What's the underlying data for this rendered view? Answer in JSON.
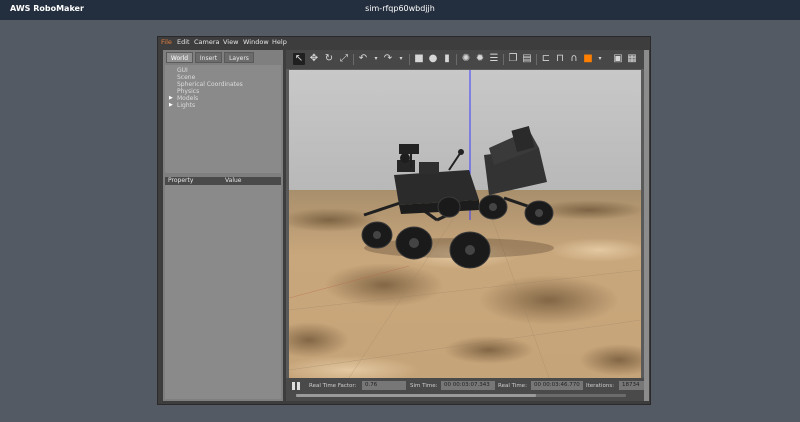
{
  "app": {
    "brand": "AWS RoboMaker",
    "sim_id": "sim-rfqp60wbdjjh"
  },
  "menu": [
    "File",
    "Edit",
    "Camera",
    "View",
    "Window",
    "Help"
  ],
  "left_panel": {
    "tabs": [
      "World",
      "Insert",
      "Layers"
    ],
    "tree": [
      "GUI",
      "Scene",
      "Spherical Coordinates",
      "Physics",
      "Models",
      "Lights"
    ],
    "props_header": [
      "Property",
      "Value"
    ]
  },
  "bottom_bar": {
    "real_time_factor_label": "Real Time Factor:",
    "real_time_factor": "0.76",
    "sim_time_label": "Sim Time:",
    "sim_time": "00 00:03:07.343",
    "real_time_label": "Real Time:",
    "real_time": "00 00:03:46.770",
    "iterations_label": "Iterations:",
    "iterations": "18734"
  },
  "colors": {
    "menu_active": "#e27d3c",
    "toolbar_accent": "#ff7f00",
    "axis_z": "#3b3bff"
  }
}
